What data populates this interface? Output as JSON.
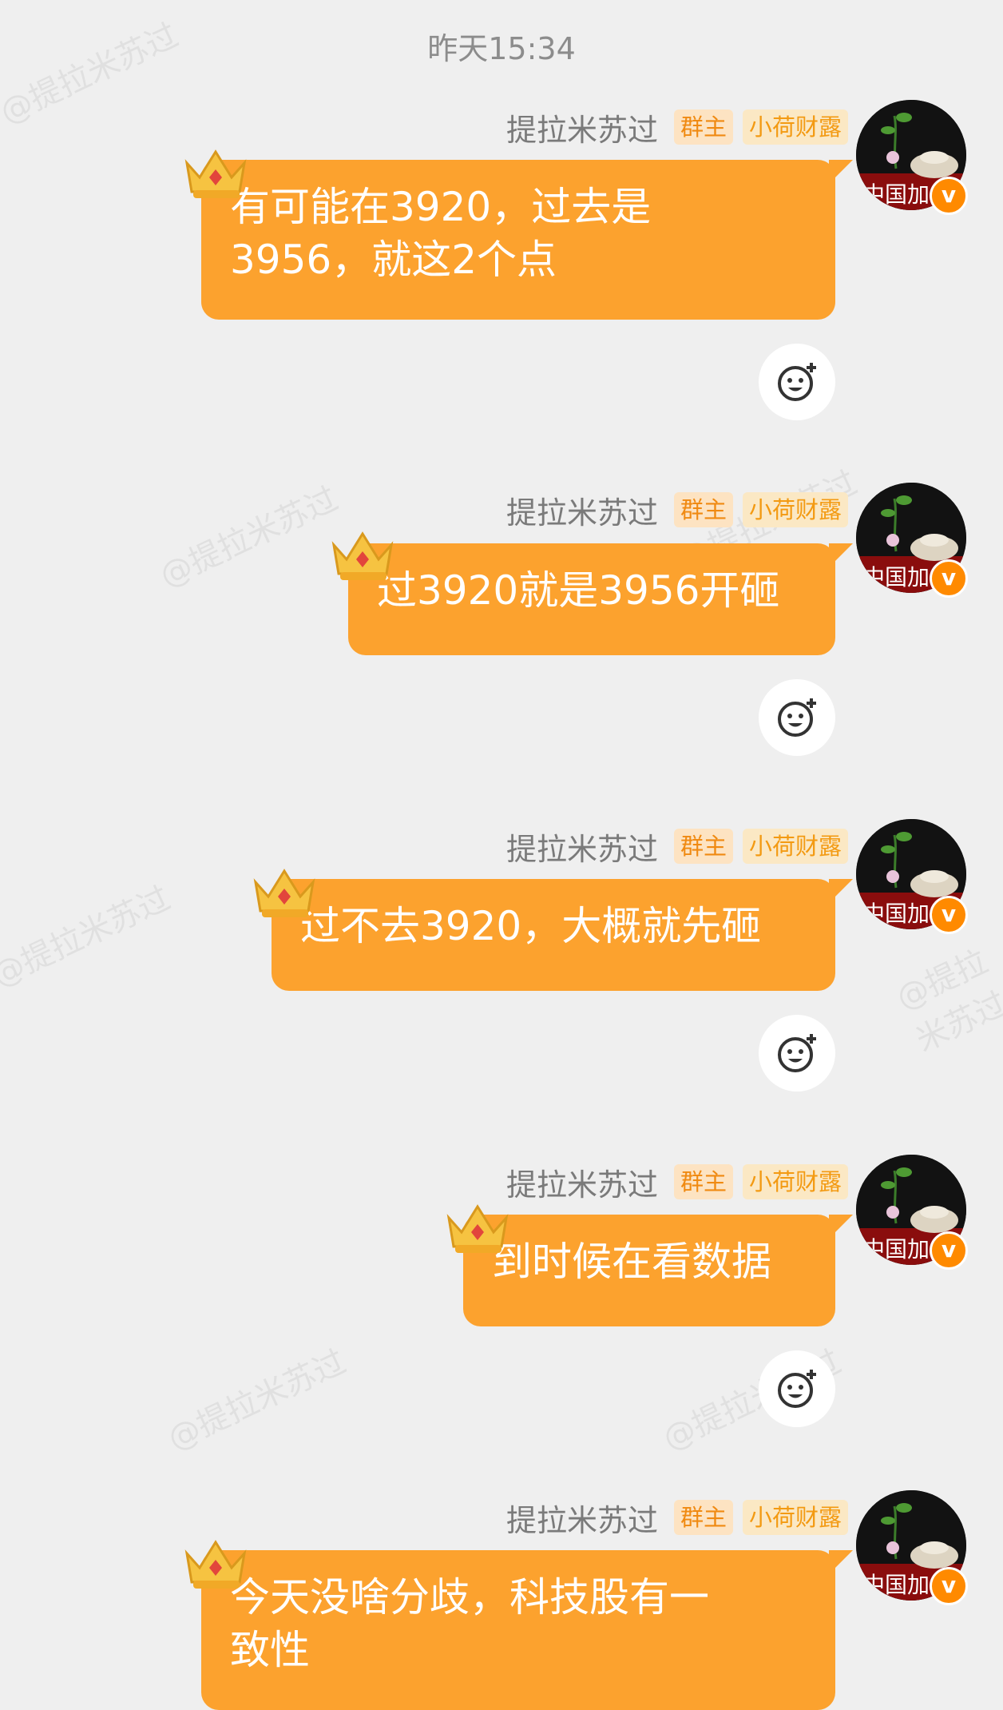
{
  "timestamp": "昨天15:34",
  "sender": {
    "name": "提拉米苏过",
    "badge_owner": "群主",
    "badge_title": "小荷财露",
    "avatar_label": "中国加",
    "verified_glyph": "v"
  },
  "watermark": "@提拉米苏过",
  "messages": [
    {
      "text": "有可能在3920，过去是\n3956，就这2个点"
    },
    {
      "text": "过3920就是3956开砸"
    },
    {
      "text": "过不去3920，大概就先砸"
    },
    {
      "text": "到时候在看数据"
    },
    {
      "text": "今天没啥分歧，科技股有一\n致性"
    }
  ],
  "icons": {
    "reaction": "add-emoji-icon",
    "crown": "crown-icon"
  },
  "colors": {
    "bubble": "#fca22e",
    "background": "#efefef",
    "badge_text": "#f39a12"
  }
}
